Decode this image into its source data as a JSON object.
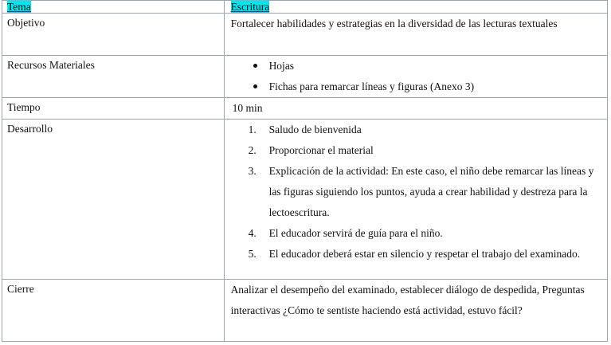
{
  "header": {
    "left": "Tema",
    "right": "Escritura"
  },
  "rows": {
    "objetivo": {
      "label": "Objetivo",
      "text": "Fortalecer habilidades y estrategias en la diversidad de las lecturas textuales"
    },
    "recursos": {
      "label": "Recursos Materiales",
      "items": [
        "Hojas",
        "Fichas para remarcar líneas y figuras (Anexo 3)"
      ]
    },
    "tiempo": {
      "label": "Tiempo",
      "value": "10 min"
    },
    "desarrollo": {
      "label": "Desarrollo",
      "steps": [
        {
          "num": "1.",
          "text": "Saludo de bienvenida"
        },
        {
          "num": "2.",
          "text": "Proporcionar el material"
        },
        {
          "num": "3.",
          "text": "Explicación de la actividad: En este caso, el niño debe remarcar las líneas y las figuras siguiendo los puntos, ayuda a crear habilidad y destreza para la lectoescritura."
        },
        {
          "num": "4.",
          "text": "El educador servirá de guía para el niño."
        },
        {
          "num": "5.",
          "text": "El educador deberá estar en silencio y respetar el trabajo del examinado."
        }
      ]
    },
    "cierre": {
      "label": "Cierre",
      "text": "Analizar el desempeño del examinado, establecer diálogo de despedida, Preguntas interactivas ¿Cómo te sentiste haciendo está actividad, estuvo fácil?"
    }
  },
  "colors": {
    "highlight": "#00e5ee",
    "border": "#9aa6b4"
  }
}
